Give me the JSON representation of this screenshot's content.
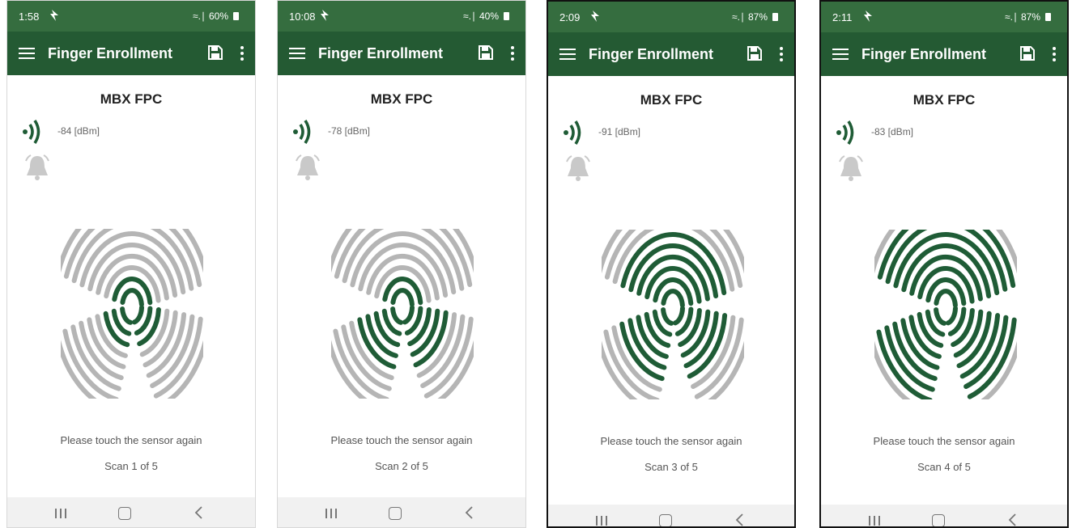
{
  "app_title": "Finger Enrollment",
  "device_name": "MBX FPC",
  "message": "Please touch the sensor again",
  "colors": {
    "status_bar": "#356d3f",
    "app_bar": "#245a33",
    "accent_green": "#1f5c36",
    "ridge_grey": "#b5b5b5"
  },
  "icons": [
    "menu-icon",
    "save-icon",
    "more-vert-icon",
    "signal-icon",
    "bell-icon",
    "fingerprint-icon",
    "recents-icon",
    "home-icon",
    "back-icon",
    "navigation-icon"
  ],
  "phones": [
    {
      "time": "1:58",
      "battery": "60%",
      "rssi": "-84 [dBm]",
      "scan": "Scan 1 of 5",
      "progress": 0.2
    },
    {
      "time": "10:08",
      "battery": "40%",
      "rssi": "-78 [dBm]",
      "scan": "Scan 2 of 5",
      "progress": 0.4
    },
    {
      "time": "2:09",
      "battery": "87%",
      "rssi": "-91 [dBm]",
      "scan": "Scan 3 of 5",
      "progress": 0.6
    },
    {
      "time": "2:11",
      "battery": "87%",
      "rssi": "-83 [dBm]",
      "scan": "Scan 4 of 5",
      "progress": 0.8
    }
  ]
}
